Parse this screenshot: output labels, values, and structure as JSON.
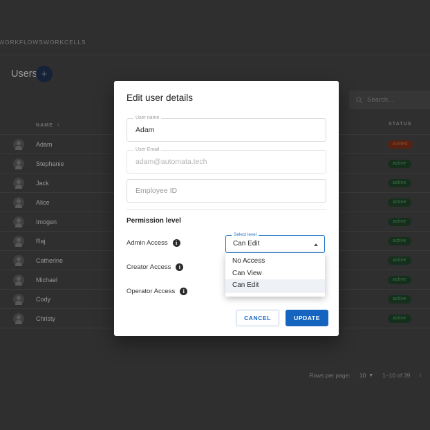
{
  "topnav": {
    "items": [
      {
        "label": "WORKFLOWS",
        "name": "nav-workflows"
      },
      {
        "label": "WORKCELLS",
        "name": "nav-workcells"
      }
    ]
  },
  "header": {
    "title": "Users",
    "add_button_glyph": "+",
    "add_button_name": "add-user-button"
  },
  "search": {
    "placeholder": "Search...",
    "value": "",
    "icon": "search-icon"
  },
  "table": {
    "columns": [
      {
        "key": "name",
        "label": "NAME",
        "sort": "ascending",
        "sort_glyph": "↑"
      },
      {
        "key": "status",
        "label": "STATUS"
      }
    ],
    "rows": [
      {
        "name": "Adam",
        "status": "invited"
      },
      {
        "name": "Stephanie",
        "status": "active"
      },
      {
        "name": "Jack",
        "status": "active"
      },
      {
        "name": "Alice",
        "status": "active"
      },
      {
        "name": "Imogen",
        "status": "active"
      },
      {
        "name": "Raj",
        "status": "active"
      },
      {
        "name": "Catherine",
        "status": "active"
      },
      {
        "name": "Michael",
        "status": "active"
      },
      {
        "name": "Cody",
        "status": "active"
      },
      {
        "name": "Christy",
        "status": "active"
      }
    ]
  },
  "pagination": {
    "rows_per_page_label": "Rows per page:",
    "rows_per_page_value": "10",
    "range_label": "1–10 of 39",
    "prev_glyph": "‹"
  },
  "dialog": {
    "title": "Edit user details",
    "fields": {
      "user_name": {
        "label": "User name",
        "value": "Adam"
      },
      "user_email": {
        "label": "User Email",
        "value": "adam@automata.tech"
      },
      "employee_id": {
        "label": "",
        "placeholder": "Employee ID",
        "value": ""
      }
    },
    "permission_section_title": "Permission level",
    "permissions": [
      {
        "label": "Admin Access",
        "info": "i"
      },
      {
        "label": "Creator Access",
        "info": "i"
      },
      {
        "label": "Operator Access",
        "info": "i"
      }
    ],
    "select": {
      "label": "Select level",
      "value": "Can Edit",
      "open": true,
      "options": [
        "No Access",
        "Can View",
        "Can Edit"
      ],
      "selected_index": 2
    },
    "buttons": {
      "cancel": "CANCEL",
      "update": "UPDATE"
    }
  },
  "colors": {
    "page_background": "#3a3a3a",
    "accent_blue": "#1565c0",
    "status_active_bg": "#1b3a24",
    "status_active_text": "#4e8a5e",
    "status_invited_bg": "#6b2a16",
    "status_invited_text": "#b4603c",
    "fab": "#1b2a44"
  }
}
